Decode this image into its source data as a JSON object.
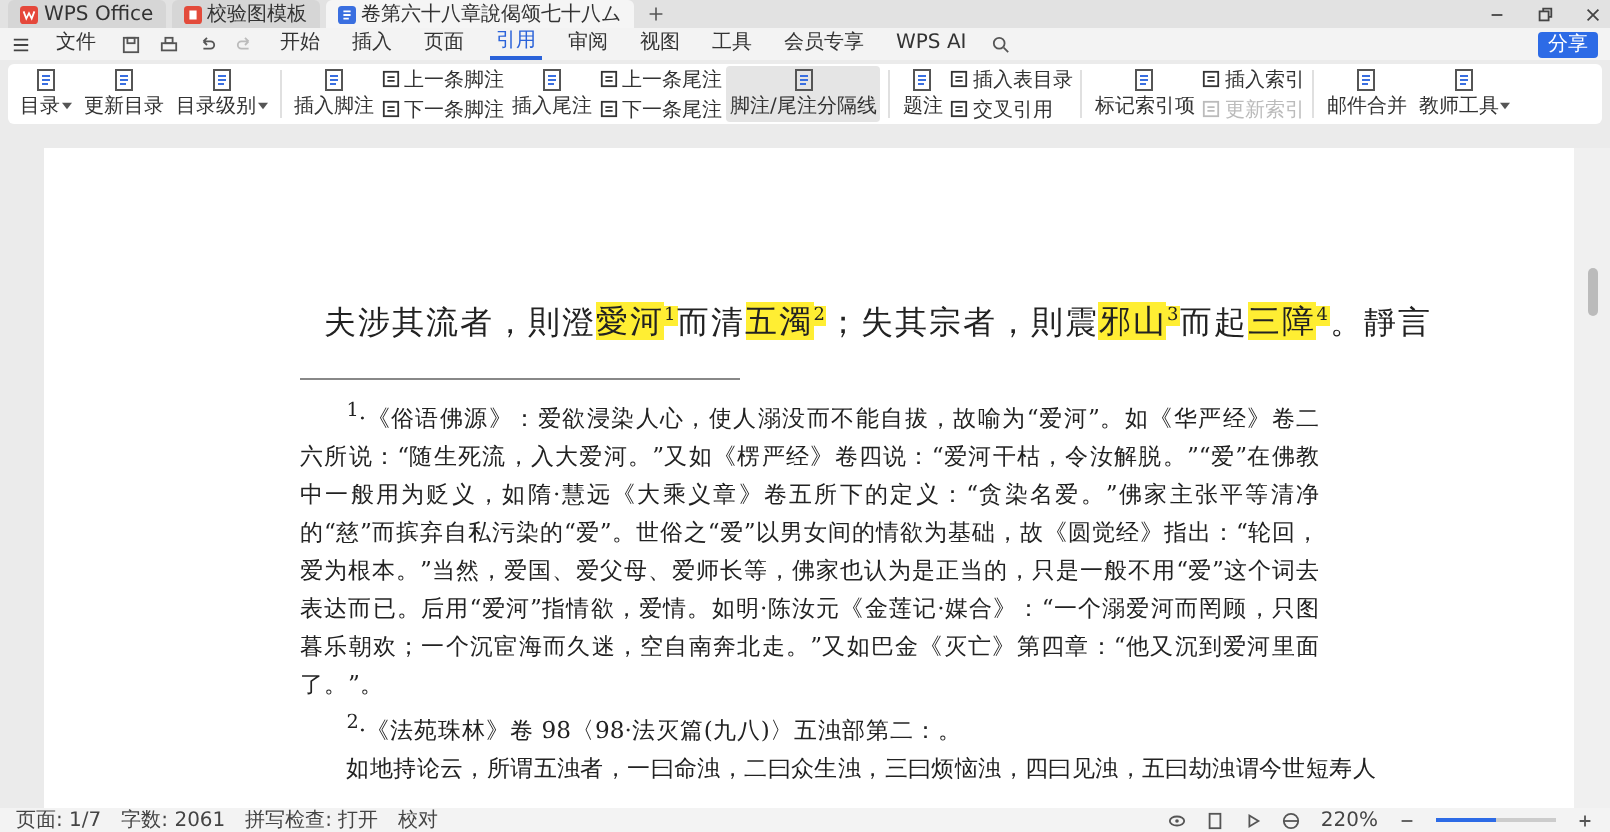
{
  "tabs": [
    {
      "label": "WPS Office",
      "kind": "home",
      "selected": false
    },
    {
      "label": "校验图模板",
      "kind": "pdf",
      "selected": false
    },
    {
      "label": "卷第六十八章說偈颂七十八ム",
      "kind": "doc",
      "selected": true
    }
  ],
  "menu": {
    "file": "文件",
    "items": [
      {
        "label": "开始",
        "selected": false
      },
      {
        "label": "插入",
        "selected": false
      },
      {
        "label": "页面",
        "selected": false
      },
      {
        "label": "引用",
        "selected": true
      },
      {
        "label": "审阅",
        "selected": false
      },
      {
        "label": "视图",
        "selected": false
      },
      {
        "label": "工具",
        "selected": false
      },
      {
        "label": "会员专享",
        "selected": false
      }
    ],
    "ai": "WPS AI",
    "share": "分享"
  },
  "ribbon": [
    {
      "items": [
        {
          "kind": "large",
          "label": "目录",
          "dropdown": true,
          "selected": false
        },
        {
          "kind": "large",
          "label": "更新目录",
          "selected": false
        },
        {
          "kind": "large",
          "label": "目录级别",
          "dropdown": true,
          "selected": false
        }
      ]
    },
    {
      "items": [
        {
          "kind": "large",
          "label": "插入脚注",
          "selected": false
        },
        {
          "kind": "pair",
          "items": [
            {
              "label": "上一条脚注",
              "disabled": false
            },
            {
              "label": "下一条脚注",
              "disabled": false
            }
          ]
        },
        {
          "kind": "large",
          "label": "插入尾注",
          "selected": false
        },
        {
          "kind": "pair",
          "items": [
            {
              "label": "上一条尾注",
              "disabled": false
            },
            {
              "label": "下一条尾注",
              "disabled": false
            }
          ]
        },
        {
          "kind": "large",
          "label": "脚注/尾注分隔线",
          "selected": true
        }
      ]
    },
    {
      "items": [
        {
          "kind": "large",
          "label": "题注",
          "selected": false
        },
        {
          "kind": "pair",
          "items": [
            {
              "label": "插入表目录",
              "disabled": false
            },
            {
              "label": "交叉引用",
              "disabled": false
            }
          ]
        }
      ]
    },
    {
      "items": [
        {
          "kind": "large",
          "label": "标记索引项",
          "selected": false
        },
        {
          "kind": "pair",
          "items": [
            {
              "label": "插入索引",
              "disabled": false
            },
            {
              "label": "更新索引",
              "disabled": true
            }
          ]
        }
      ]
    },
    {
      "items": [
        {
          "kind": "large",
          "label": "邮件合并",
          "selected": false
        },
        {
          "kind": "large",
          "label": "教师工具",
          "dropdown": true,
          "selected": false
        }
      ]
    }
  ],
  "document": {
    "main_line": [
      {
        "text": "夫涉其流者，則澄",
        "highlighted": false
      },
      {
        "text": "愛河",
        "highlighted": true,
        "note": "1"
      },
      {
        "text": "而清",
        "highlighted": false
      },
      {
        "text": "五濁",
        "highlighted": true,
        "note": "2"
      },
      {
        "text": "；失其宗者，則震",
        "highlighted": false
      },
      {
        "text": "邪山",
        "highlighted": true,
        "note": "3"
      },
      {
        "text": "而起",
        "highlighted": false
      },
      {
        "text": "三障",
        "highlighted": true,
        "note": "4"
      },
      {
        "text": "。靜言",
        "highlighted": false
      }
    ],
    "footnotes": [
      "$^{1}$·《俗语佛源》：爱欲浸染人心，使人溺没而不能自拔，故喻为“爱河”。如《华严经》卷二六所说：“随生死流，入大爱河。”又如《楞严经》卷四说：“爱河干枯，令汝解脱。”“爱”在佛教中一般用为贬义，如隋·慧远《大乘义章》卷五所下的定义：“贪染名爱。”佛家主张平等清净的“慈”而摈弃自私污染的“爱”。世俗之“爱”以男女间的情欲为基础，故《圆觉经》指出：“轮回，爱为根本。”当然，爱国、爱父母、爱师长等，佛家也认为是正当的，只是一般不用“爱”这个词去表达而已。后用“爱河”指情欲，爱情。如明·陈汝元《金莲记·媒合》：“一个溺爱河而罔顾，只图暮乐朝欢；一个沉宦海而久迷，空自南奔北走。”又如巴金《灭亡》第四章：“他又沉到爱河里面了。”。",
      "$^{2}$·《法苑珠林》卷 98〈98·法灭篇(九八)〉五浊部第二：。",
      "如地持论云，所谓五浊者，一曰命浊，二曰众生浊，三曰烦恼浊，四曰见浊，五曰劫浊谓今世短寿人"
    ]
  },
  "status_bar": {
    "page": "页面: 1/7",
    "words": "字数: 2061",
    "spell": "拼写检查: 打开",
    "proofread": "校对",
    "zoom": "220%",
    "zoom_slider": {
      "level": 0.5
    }
  }
}
